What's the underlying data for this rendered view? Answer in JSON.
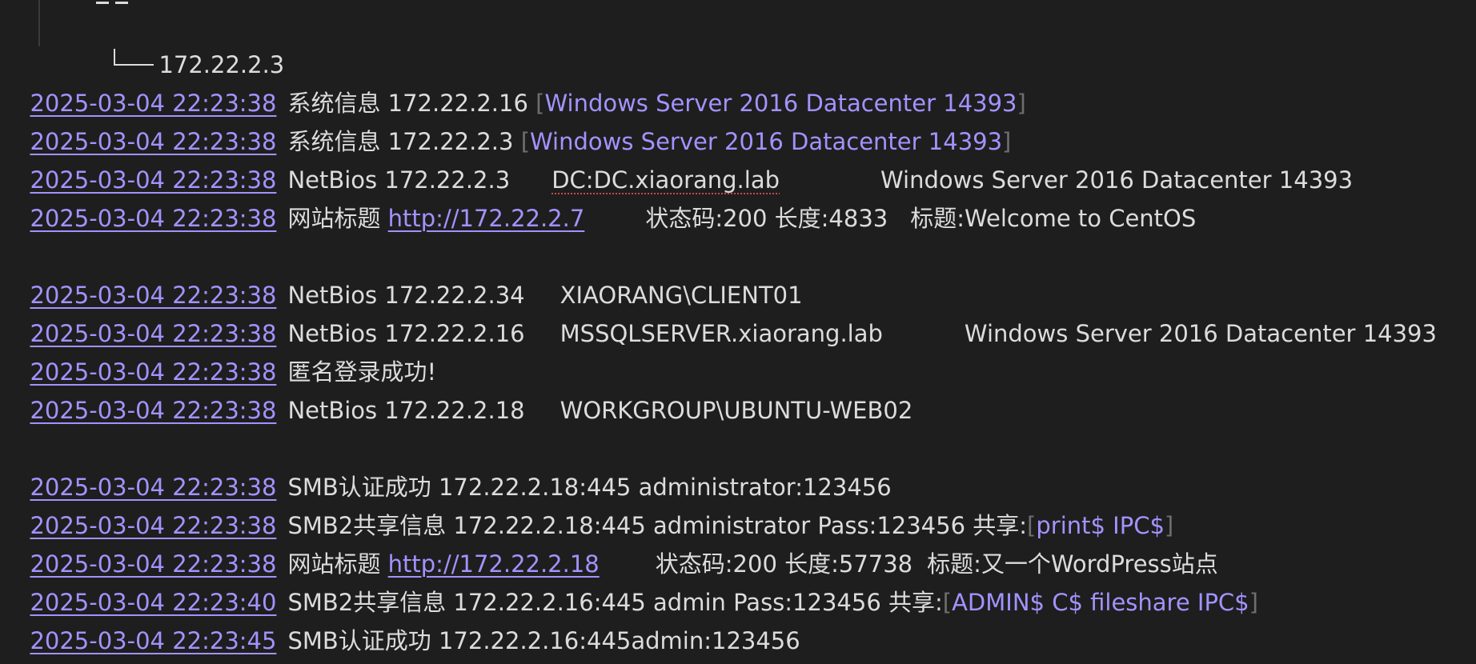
{
  "tree": {
    "ip": "172.22.2.3"
  },
  "lines": [
    {
      "timestamp": "2025-03-04 22:23:38",
      "prefix": "系统信息 172.22.2.16 ",
      "os": "Windows Server 2016 Datacenter 14393"
    },
    {
      "timestamp": "2025-03-04 22:23:38",
      "prefix": "系统信息 172.22.2.3 ",
      "os": "Windows Server 2016 Datacenter 14393"
    },
    {
      "timestamp": "2025-03-04 22:23:38",
      "prefix": "NetBios 172.22.2.3",
      "host": "DC:DC.xiaorang.lab",
      "os": "Windows Server 2016 Datacenter 14393"
    },
    {
      "timestamp": "2025-03-04 22:23:38",
      "prefix": "网站标题 ",
      "url": "http://172.22.2.7",
      "status": "状态码:200 长度:4833",
      "title": "标题:Welcome to CentOS"
    },
    {
      "timestamp": "2025-03-04 22:23:38",
      "prefix": "NetBios 172.22.2.34",
      "host": "XIAORANG\\CLIENT01"
    },
    {
      "timestamp": "2025-03-04 22:23:38",
      "prefix": "NetBios 172.22.2.16",
      "host": "MSSQLSERVER.xiaorang.lab",
      "os": "Windows Server 2016 Datacenter 14393"
    },
    {
      "timestamp": "2025-03-04 22:23:38",
      "prefix": "匿名登录成功!"
    },
    {
      "timestamp": "2025-03-04 22:23:38",
      "prefix": "NetBios 172.22.2.18",
      "host": "WORKGROUP\\UBUNTU-WEB02"
    },
    {
      "timestamp": "2025-03-04 22:23:38",
      "prefix": "SMB认证成功 172.22.2.18:445 administrator:123456"
    },
    {
      "timestamp": "2025-03-04 22:23:38",
      "prefix": "SMB2共享信息 172.22.2.18:445 administrator Pass:123456 共享:",
      "shares": "print$ IPC$"
    },
    {
      "timestamp": "2025-03-04 22:23:38",
      "prefix": "网站标题 ",
      "url": "http://172.22.2.18",
      "status": "状态码:200 长度:57738",
      "title": "标题:又一个WordPress站点"
    },
    {
      "timestamp": "2025-03-04 22:23:40",
      "prefix": "SMB2共享信息 172.22.2.16:445 admin Pass:123456 共享:",
      "shares": "ADMIN$ C$ fileshare IPC$"
    },
    {
      "timestamp": "2025-03-04 22:23:45",
      "prefix": "SMB认证成功 172.22.2.16:445admin:123456"
    }
  ],
  "colors": {
    "background": "#1e1e1e",
    "text": "#dcdcdc",
    "link": "#a293ff",
    "bracket": "#6e6e6e"
  }
}
